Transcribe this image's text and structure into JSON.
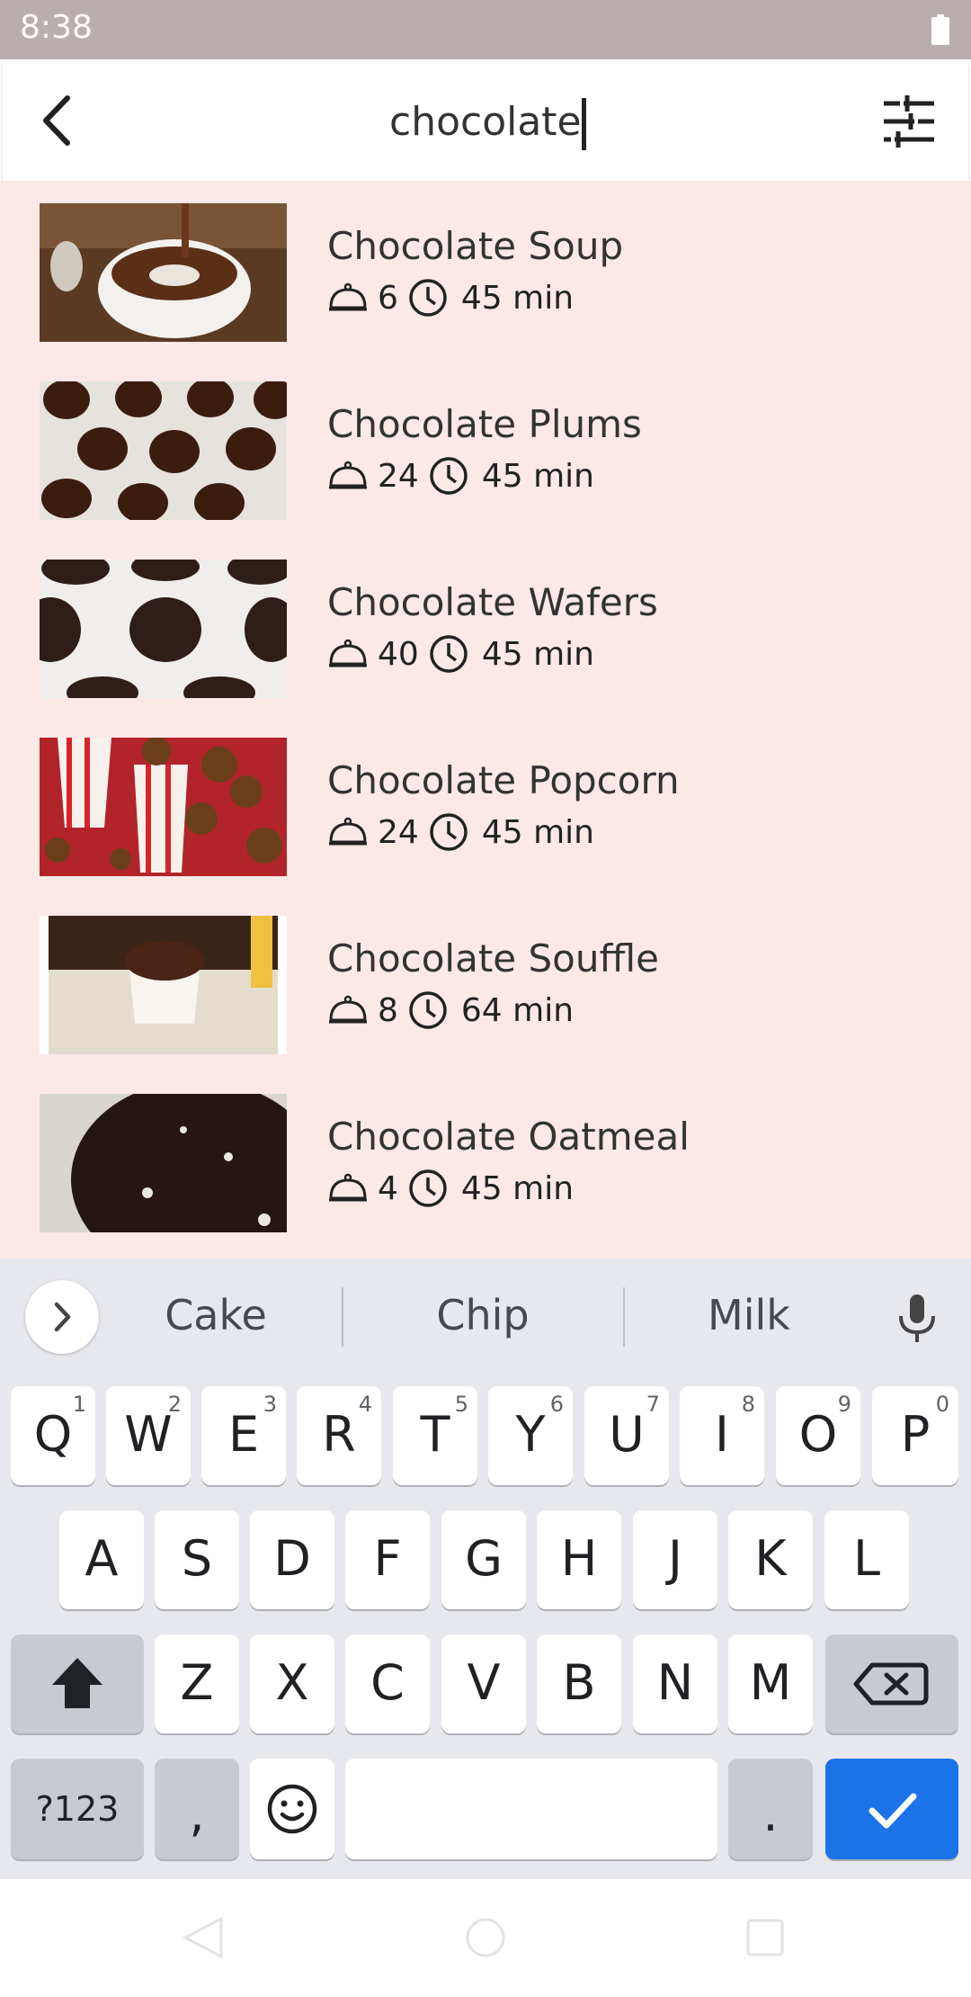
{
  "status_bar": {
    "time": "8:38"
  },
  "search": {
    "query": "chocolate"
  },
  "recipes": [
    {
      "title": "Chocolate Soup",
      "servings": "6",
      "time": "45 min"
    },
    {
      "title": "Chocolate Plums",
      "servings": "24",
      "time": "45 min"
    },
    {
      "title": "Chocolate Wafers",
      "servings": "40",
      "time": "45 min"
    },
    {
      "title": "Chocolate Popcorn",
      "servings": "24",
      "time": "45 min"
    },
    {
      "title": "Chocolate Souffle",
      "servings": "8",
      "time": "64 min"
    },
    {
      "title": "Chocolate Oatmeal",
      "servings": "4",
      "time": "45 min"
    }
  ],
  "keyboard": {
    "suggestions": [
      "Cake",
      "Chip",
      "Milk"
    ],
    "row1": [
      {
        "label": "Q",
        "hint": "1"
      },
      {
        "label": "W",
        "hint": "2"
      },
      {
        "label": "E",
        "hint": "3"
      },
      {
        "label": "R",
        "hint": "4"
      },
      {
        "label": "T",
        "hint": "5"
      },
      {
        "label": "Y",
        "hint": "6"
      },
      {
        "label": "U",
        "hint": "7"
      },
      {
        "label": "I",
        "hint": "8"
      },
      {
        "label": "O",
        "hint": "9"
      },
      {
        "label": "P",
        "hint": "0"
      }
    ],
    "row2": [
      "A",
      "S",
      "D",
      "F",
      "G",
      "H",
      "J",
      "K",
      "L"
    ],
    "row3": [
      "Z",
      "X",
      "C",
      "V",
      "B",
      "N",
      "M"
    ],
    "symbols_label": "?123",
    "comma_label": ",",
    "period_label": "."
  },
  "colors": {
    "status_bar": "#b9aeae",
    "results_background": "#fde8e8",
    "keyboard_background": "#e7e8ed",
    "action_key": "#1a73e8"
  }
}
